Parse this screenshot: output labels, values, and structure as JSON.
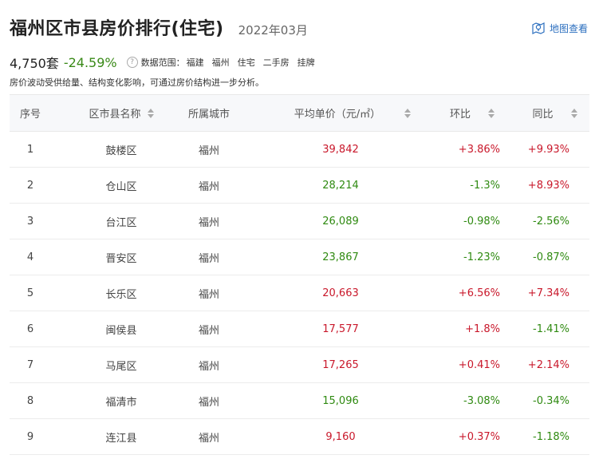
{
  "header": {
    "title": "福州区市县房价排行(住宅)",
    "date": "2022年03月"
  },
  "map_link": {
    "label": "地图查看",
    "icon": "map-pin-icon"
  },
  "summary": {
    "count": "4,750套",
    "change": "-24.59%",
    "range_label": "数据范围：",
    "range_items": [
      "福建",
      "福州",
      "住宅",
      "二手房",
      "挂牌"
    ],
    "note": "房价波动受供给量、结构变化影响，可通过房价结构进一步分析。"
  },
  "colors": {
    "up": "#c9182b",
    "down": "#2f8a11",
    "link": "#2c6fbf"
  },
  "table": {
    "columns": [
      "序号",
      "区市县名称",
      "所属城市",
      "平均单价（元/㎡）",
      "环比",
      "同比"
    ],
    "rows": [
      {
        "rank": "1",
        "district": "鼓楼区",
        "city": "福州",
        "price": "39,842",
        "mom": "+3.86%",
        "yoy": "+9.93%",
        "price_dir": "up",
        "mom_dir": "up",
        "yoy_dir": "up"
      },
      {
        "rank": "2",
        "district": "仓山区",
        "city": "福州",
        "price": "28,214",
        "mom": "-1.3%",
        "yoy": "+8.93%",
        "price_dir": "down",
        "mom_dir": "down",
        "yoy_dir": "up"
      },
      {
        "rank": "3",
        "district": "台江区",
        "city": "福州",
        "price": "26,089",
        "mom": "-0.98%",
        "yoy": "-2.56%",
        "price_dir": "down",
        "mom_dir": "down",
        "yoy_dir": "down"
      },
      {
        "rank": "4",
        "district": "晋安区",
        "city": "福州",
        "price": "23,867",
        "mom": "-1.23%",
        "yoy": "-0.87%",
        "price_dir": "down",
        "mom_dir": "down",
        "yoy_dir": "down"
      },
      {
        "rank": "5",
        "district": "长乐区",
        "city": "福州",
        "price": "20,663",
        "mom": "+6.56%",
        "yoy": "+7.34%",
        "price_dir": "up",
        "mom_dir": "up",
        "yoy_dir": "up"
      },
      {
        "rank": "6",
        "district": "闽侯县",
        "city": "福州",
        "price": "17,577",
        "mom": "+1.8%",
        "yoy": "-1.41%",
        "price_dir": "up",
        "mom_dir": "up",
        "yoy_dir": "down"
      },
      {
        "rank": "7",
        "district": "马尾区",
        "city": "福州",
        "price": "17,265",
        "mom": "+0.41%",
        "yoy": "+2.14%",
        "price_dir": "up",
        "mom_dir": "up",
        "yoy_dir": "up"
      },
      {
        "rank": "8",
        "district": "福清市",
        "city": "福州",
        "price": "15,096",
        "mom": "-3.08%",
        "yoy": "-0.34%",
        "price_dir": "down",
        "mom_dir": "down",
        "yoy_dir": "down"
      },
      {
        "rank": "9",
        "district": "连江县",
        "city": "福州",
        "price": "9,160",
        "mom": "+0.37%",
        "yoy": "-1.18%",
        "price_dir": "up",
        "mom_dir": "up",
        "yoy_dir": "down"
      }
    ]
  }
}
